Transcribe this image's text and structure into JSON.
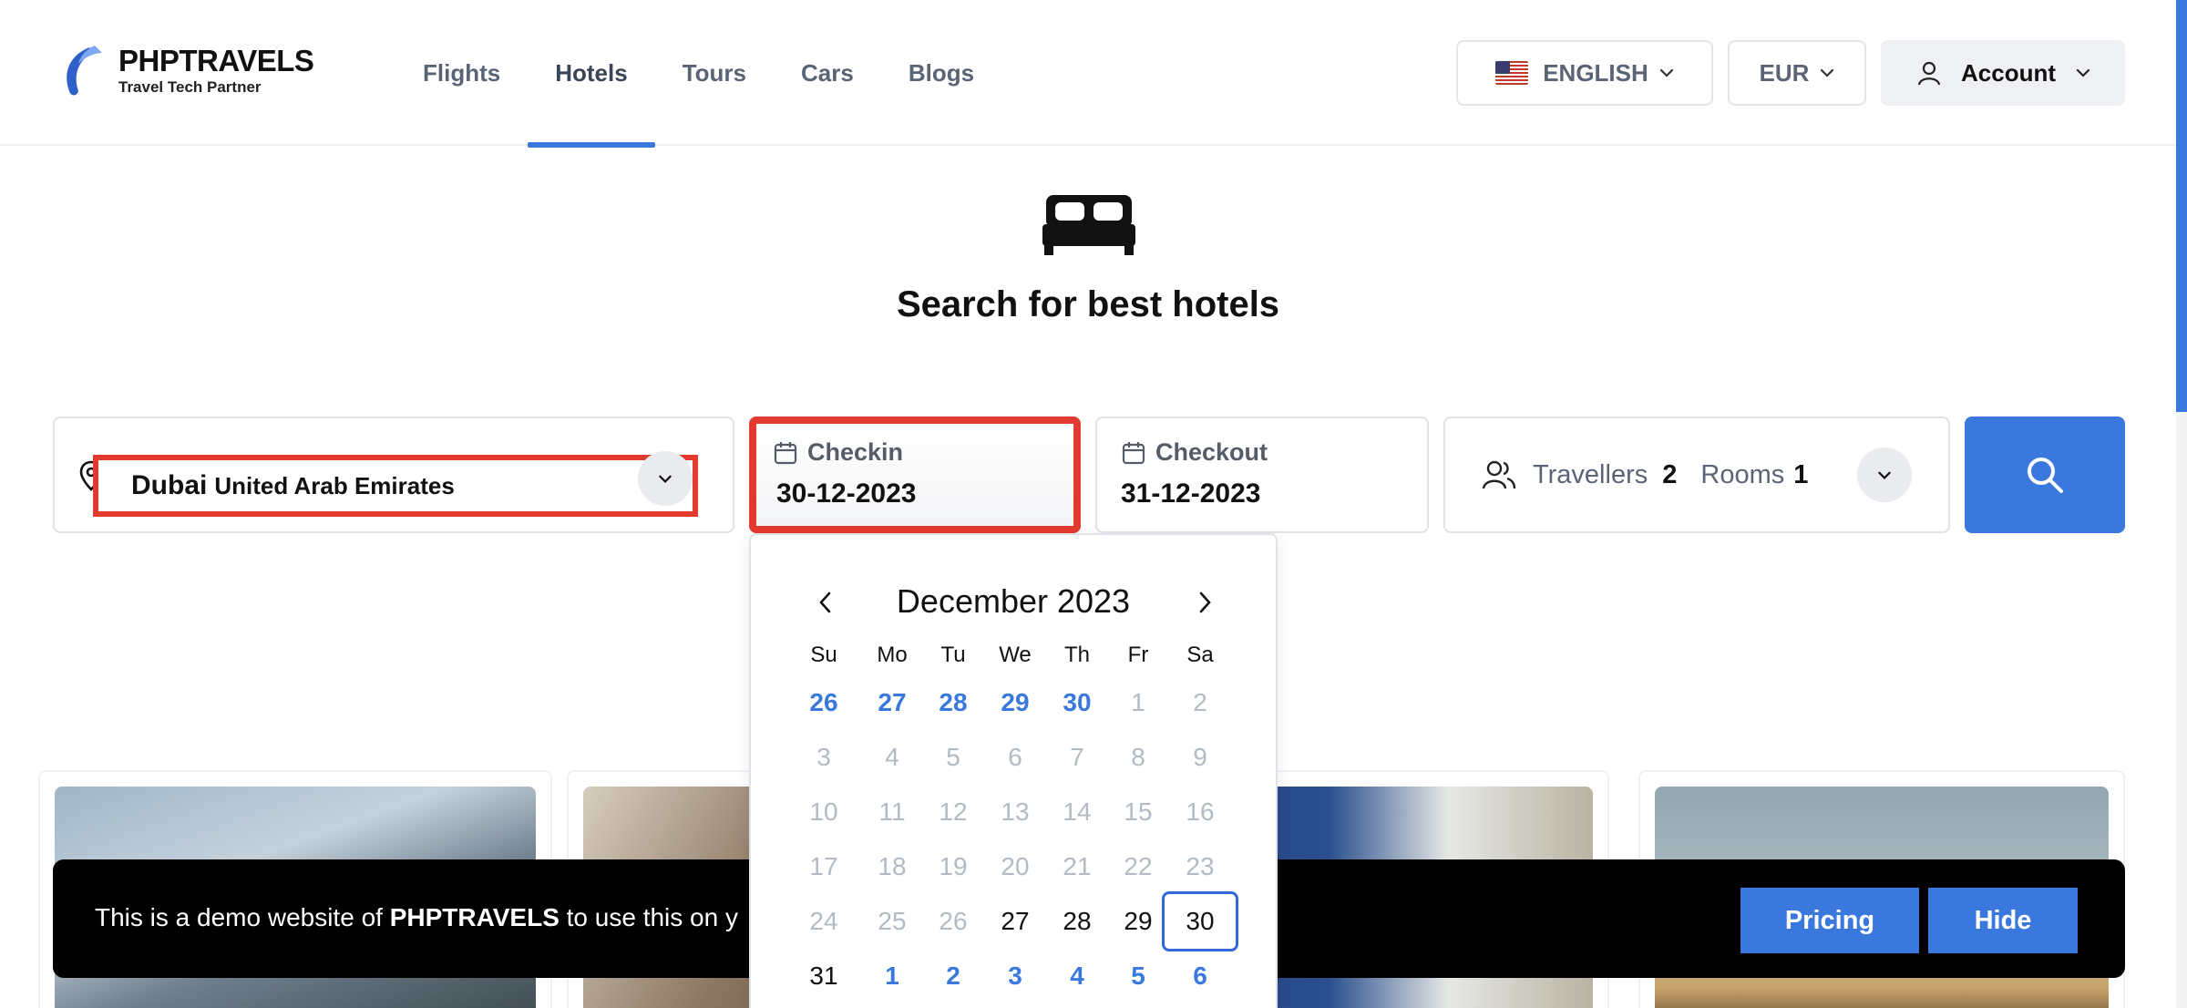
{
  "brand": {
    "name": "PHPTRAVELS",
    "tagline": "Travel Tech Partner"
  },
  "nav": [
    {
      "label": "Flights",
      "active": false
    },
    {
      "label": "Hotels",
      "active": true
    },
    {
      "label": "Tours",
      "active": false
    },
    {
      "label": "Cars",
      "active": false
    },
    {
      "label": "Blogs",
      "active": false
    }
  ],
  "header": {
    "language": "ENGLISH",
    "currency": "EUR",
    "account": "Account"
  },
  "hero": {
    "title": "Search for best hotels",
    "icon": "bed-icon"
  },
  "search": {
    "destination_city": "Dubai",
    "destination_country": "United Arab Emirates",
    "checkin_label": "Checkin",
    "checkin_value": "30-12-2023",
    "checkout_label": "Checkout",
    "checkout_value": "31-12-2023",
    "travellers_label": "Travellers",
    "travellers_value": "2",
    "rooms_label": "Rooms",
    "rooms_value": "1"
  },
  "calendar": {
    "month": "December 2023",
    "weekdays": [
      "Su",
      "Mo",
      "Tu",
      "We",
      "Th",
      "Fr",
      "Sa"
    ],
    "selected": "30",
    "weeks": [
      [
        {
          "d": "26",
          "s": "blue"
        },
        {
          "d": "27",
          "s": "blue"
        },
        {
          "d": "28",
          "s": "blue"
        },
        {
          "d": "29",
          "s": "blue"
        },
        {
          "d": "30",
          "s": "blue"
        },
        {
          "d": "1",
          "s": "muted"
        },
        {
          "d": "2",
          "s": "muted"
        }
      ],
      [
        {
          "d": "3",
          "s": "muted"
        },
        {
          "d": "4",
          "s": "muted"
        },
        {
          "d": "5",
          "s": "muted"
        },
        {
          "d": "6",
          "s": "muted"
        },
        {
          "d": "7",
          "s": "muted"
        },
        {
          "d": "8",
          "s": "muted"
        },
        {
          "d": "9",
          "s": "muted"
        }
      ],
      [
        {
          "d": "10",
          "s": "muted"
        },
        {
          "d": "11",
          "s": "muted"
        },
        {
          "d": "12",
          "s": "muted"
        },
        {
          "d": "13",
          "s": "muted"
        },
        {
          "d": "14",
          "s": "muted"
        },
        {
          "d": "15",
          "s": "muted"
        },
        {
          "d": "16",
          "s": "muted"
        }
      ],
      [
        {
          "d": "17",
          "s": "muted"
        },
        {
          "d": "18",
          "s": "muted"
        },
        {
          "d": "19",
          "s": "muted"
        },
        {
          "d": "20",
          "s": "muted"
        },
        {
          "d": "21",
          "s": "muted"
        },
        {
          "d": "22",
          "s": "muted"
        },
        {
          "d": "23",
          "s": "muted"
        }
      ],
      [
        {
          "d": "24",
          "s": "muted"
        },
        {
          "d": "25",
          "s": "muted"
        },
        {
          "d": "26",
          "s": "muted"
        },
        {
          "d": "27",
          "s": "normal"
        },
        {
          "d": "28",
          "s": "normal"
        },
        {
          "d": "29",
          "s": "normal"
        },
        {
          "d": "30",
          "s": "selected"
        }
      ],
      [
        {
          "d": "31",
          "s": "normal"
        },
        {
          "d": "1",
          "s": "blue"
        },
        {
          "d": "2",
          "s": "blue"
        },
        {
          "d": "3",
          "s": "blue"
        },
        {
          "d": "4",
          "s": "blue"
        },
        {
          "d": "5",
          "s": "blue"
        },
        {
          "d": "6",
          "s": "blue"
        }
      ]
    ]
  },
  "banner": {
    "text_before": "This is a demo website of ",
    "text_brand": "PHPTRAVELS",
    "text_after": " to use this on y",
    "pricing_label": "Pricing",
    "hide_label": "Hide"
  },
  "colors": {
    "accent": "#3a78dd",
    "highlight": "#e23a2e",
    "banner": "#000000"
  }
}
